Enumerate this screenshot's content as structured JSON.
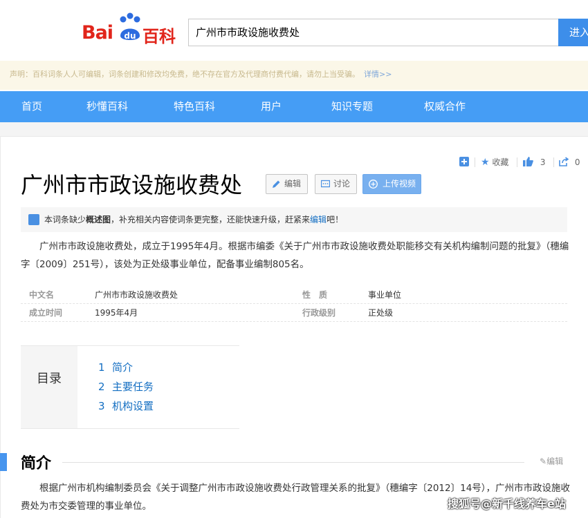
{
  "header": {
    "logo_text_left": "Bai",
    "logo_text_paw": "du",
    "logo_text_right": "百科",
    "search_value": "广州市市政设施收费处",
    "search_button": "进入"
  },
  "notice": {
    "text": "声明：百科词条人人可编辑，词条创建和修改均免费，绝不存在官方及代理商付费代编，请勿上当受骗。",
    "link": "详情>>"
  },
  "nav": {
    "items": [
      {
        "label": "首页"
      },
      {
        "label": "秒懂百科"
      },
      {
        "label": "特色百科"
      },
      {
        "label": "用户"
      },
      {
        "label": "知识专题"
      },
      {
        "label": "权威合作"
      }
    ]
  },
  "toolbar": {
    "favorite_label": "收藏",
    "like_count": "3",
    "share_count": "0"
  },
  "entry": {
    "title": "广州市市政设施收费处",
    "edit_label": "编辑",
    "discuss_label": "讨论",
    "upload_video_label": "上传视频"
  },
  "tip": {
    "before": "本词条缺少",
    "bold": "概述图",
    "middle": "，补充相关内容使词条更完整，还能快速升级，赶紧来",
    "link": "编辑",
    "after": "吧！"
  },
  "summary": "广州市市政设施收费处，成立于1995年4月。根据市编委《关于广州市市政设施收费处职能移交有关机构编制问题的批复》（穗编字〔2009〕251号），该处为正处级事业单位，配备事业编制805名。",
  "info": {
    "rows": [
      {
        "k1": "中文名",
        "v1": "广州市市政设施收费处",
        "k2": "性　质",
        "v2": "事业单位"
      },
      {
        "k1": "成立时间",
        "v1": "1995年4月",
        "k2": "行政级别",
        "v2": "正处级"
      }
    ]
  },
  "toc": {
    "label": "目录",
    "items": [
      {
        "num": "1",
        "label": "简介"
      },
      {
        "num": "2",
        "label": "主要任务"
      },
      {
        "num": "3",
        "label": "机构设置"
      }
    ]
  },
  "section": {
    "title": "简介",
    "edit_label": "编辑",
    "text": "根据广州市机构编制委员会《关于调整广州市市政设施收费处行政管理关系的批复》（穗编字〔2012〕14号），广州市市政设施收费处为市交委管理的事业单位。"
  },
  "watermark": "搜狐号@新千线养车e站",
  "colors": {
    "brand_red": "#e1251b",
    "brand_blue": "#2d6cdf",
    "nav_blue": "#459df5",
    "link_blue": "#136ec2"
  }
}
